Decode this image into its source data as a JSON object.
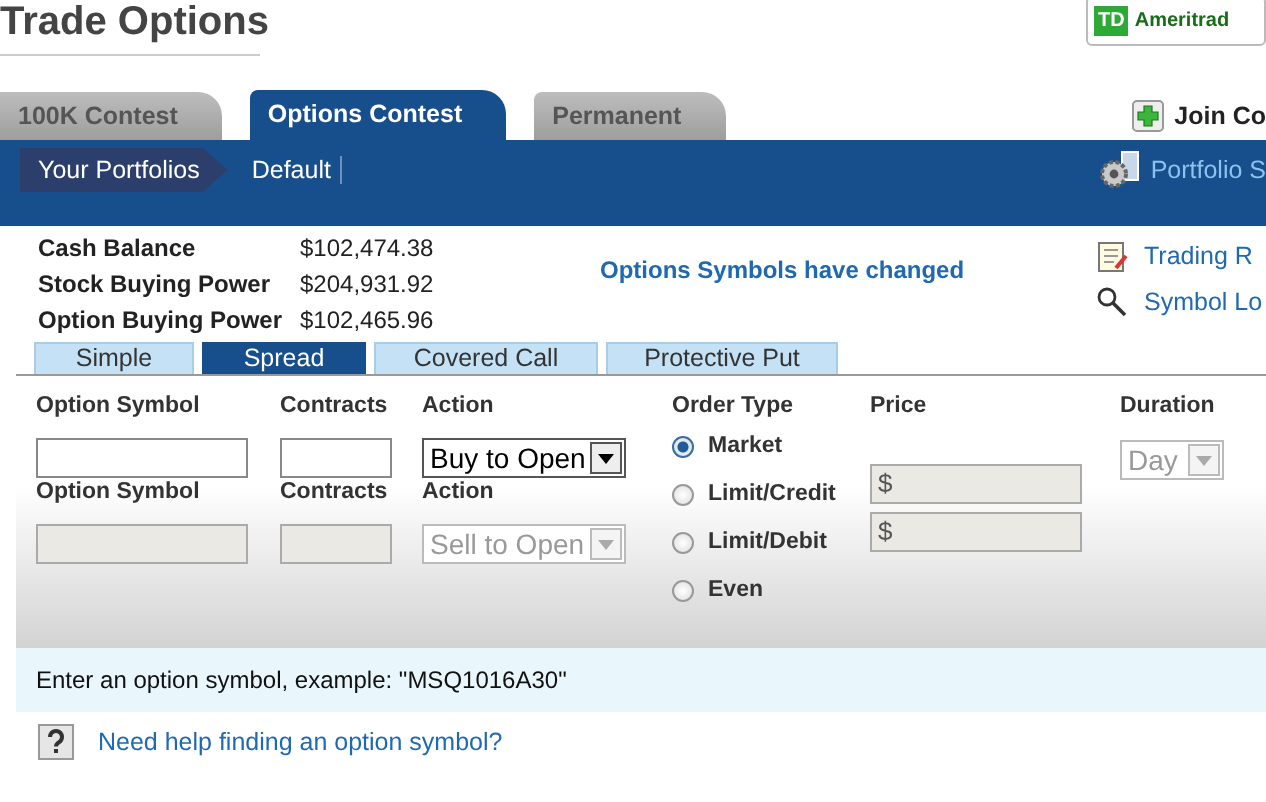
{
  "title": "Trade Options",
  "logo": {
    "badge": "TD",
    "text": "Ameritrad"
  },
  "tabs": [
    {
      "label": "100K Contest",
      "selected": false
    },
    {
      "label": "Options Contest",
      "selected": true
    },
    {
      "label": "Permanent",
      "selected": false
    }
  ],
  "join_link": "Join Co",
  "breadcrumb": [
    "Your Portfolios",
    "Default"
  ],
  "portfolio_link": "Portfolio S",
  "balances": [
    {
      "label": "Cash Balance",
      "value": "$102,474.38"
    },
    {
      "label": "Stock Buying Power",
      "value": "$204,931.92"
    },
    {
      "label": "Option Buying Power",
      "value": "$102,465.96"
    }
  ],
  "notice": "Options Symbols have changed",
  "side_links": [
    {
      "kind": "notes",
      "label": "Trading R"
    },
    {
      "kind": "search",
      "label": "Symbol Lo"
    }
  ],
  "order_tabs": [
    {
      "label": "Simple",
      "selected": false
    },
    {
      "label": "Spread",
      "selected": true
    },
    {
      "label": "Covered Call",
      "selected": false
    },
    {
      "label": "Protective Put",
      "selected": false
    }
  ],
  "legs": [
    {
      "symbol_label": "Option Symbol",
      "contracts_label": "Contracts",
      "action_label": "Action",
      "action": "Buy to Open",
      "disabled": false
    },
    {
      "symbol_label": "Option Symbol",
      "contracts_label": "Contracts",
      "action_label": "Action",
      "action": "Sell to Open",
      "disabled": true
    }
  ],
  "order_type": {
    "label": "Order Type",
    "price_label": "Price",
    "options": [
      {
        "label": "Market",
        "selected": true
      },
      {
        "label": "Limit/Credit",
        "selected": false,
        "price_prefix": "$"
      },
      {
        "label": "Limit/Debit",
        "selected": false,
        "price_prefix": "$"
      },
      {
        "label": "Even",
        "selected": false
      }
    ]
  },
  "duration": {
    "label": "Duration",
    "value": "Day",
    "disabled": true
  },
  "hint": "Enter an option symbol, example: \"MSQ1016A30\"",
  "help_link": "Need help finding an option symbol?"
}
